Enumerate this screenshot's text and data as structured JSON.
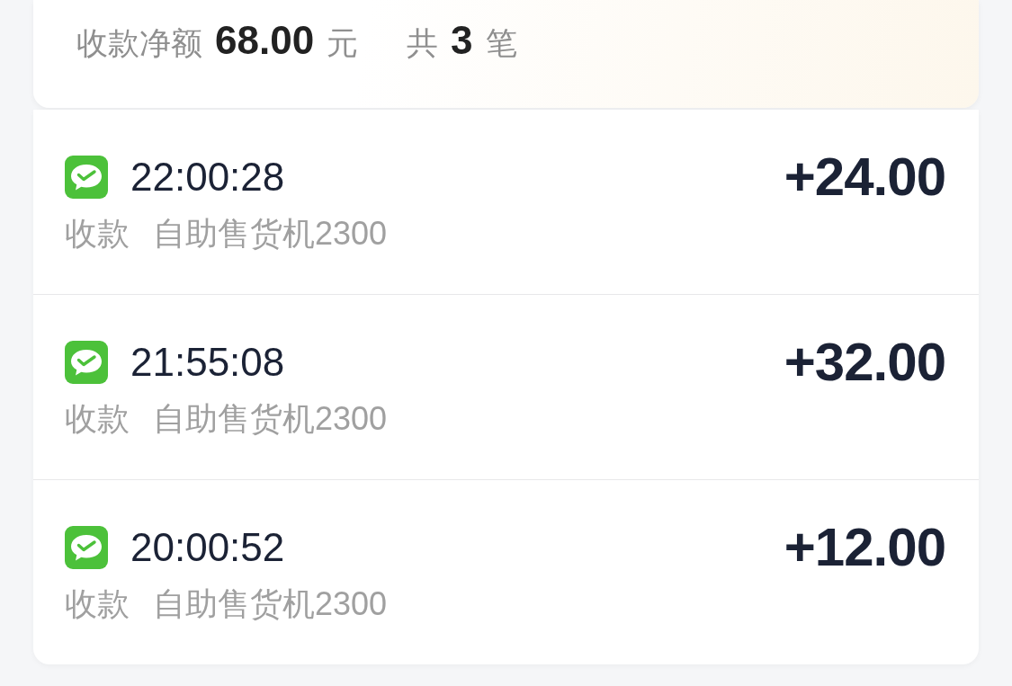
{
  "summary": {
    "net_label": "收款净额",
    "net_amount": "68.00",
    "net_unit": "元",
    "count_prefix": "共",
    "count": "3",
    "count_unit": "笔"
  },
  "transactions": [
    {
      "time": "22:00:28",
      "type": "收款",
      "merchant": "自助售货机2300",
      "amount": "+24.00"
    },
    {
      "time": "21:55:08",
      "type": "收款",
      "merchant": "自助售货机2300",
      "amount": "+32.00"
    },
    {
      "time": "20:00:52",
      "type": "收款",
      "merchant": "自助售货机2300",
      "amount": "+12.00"
    }
  ]
}
